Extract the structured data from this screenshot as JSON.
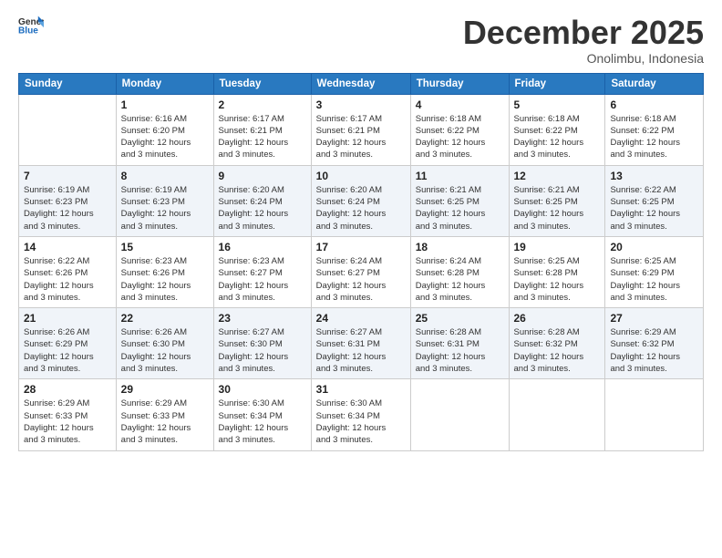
{
  "logo": {
    "general": "General",
    "blue": "Blue"
  },
  "header": {
    "month": "December 2025",
    "location": "Onolimbu, Indonesia"
  },
  "weekdays": [
    "Sunday",
    "Monday",
    "Tuesday",
    "Wednesday",
    "Thursday",
    "Friday",
    "Saturday"
  ],
  "weeks": [
    [
      {
        "day": "",
        "info": ""
      },
      {
        "day": "1",
        "info": "Sunrise: 6:16 AM\nSunset: 6:20 PM\nDaylight: 12 hours\nand 3 minutes."
      },
      {
        "day": "2",
        "info": "Sunrise: 6:17 AM\nSunset: 6:21 PM\nDaylight: 12 hours\nand 3 minutes."
      },
      {
        "day": "3",
        "info": "Sunrise: 6:17 AM\nSunset: 6:21 PM\nDaylight: 12 hours\nand 3 minutes."
      },
      {
        "day": "4",
        "info": "Sunrise: 6:18 AM\nSunset: 6:22 PM\nDaylight: 12 hours\nand 3 minutes."
      },
      {
        "day": "5",
        "info": "Sunrise: 6:18 AM\nSunset: 6:22 PM\nDaylight: 12 hours\nand 3 minutes."
      },
      {
        "day": "6",
        "info": "Sunrise: 6:18 AM\nSunset: 6:22 PM\nDaylight: 12 hours\nand 3 minutes."
      }
    ],
    [
      {
        "day": "7",
        "info": "Sunrise: 6:19 AM\nSunset: 6:23 PM\nDaylight: 12 hours\nand 3 minutes."
      },
      {
        "day": "8",
        "info": "Sunrise: 6:19 AM\nSunset: 6:23 PM\nDaylight: 12 hours\nand 3 minutes."
      },
      {
        "day": "9",
        "info": "Sunrise: 6:20 AM\nSunset: 6:24 PM\nDaylight: 12 hours\nand 3 minutes."
      },
      {
        "day": "10",
        "info": "Sunrise: 6:20 AM\nSunset: 6:24 PM\nDaylight: 12 hours\nand 3 minutes."
      },
      {
        "day": "11",
        "info": "Sunrise: 6:21 AM\nSunset: 6:25 PM\nDaylight: 12 hours\nand 3 minutes."
      },
      {
        "day": "12",
        "info": "Sunrise: 6:21 AM\nSunset: 6:25 PM\nDaylight: 12 hours\nand 3 minutes."
      },
      {
        "day": "13",
        "info": "Sunrise: 6:22 AM\nSunset: 6:25 PM\nDaylight: 12 hours\nand 3 minutes."
      }
    ],
    [
      {
        "day": "14",
        "info": "Sunrise: 6:22 AM\nSunset: 6:26 PM\nDaylight: 12 hours\nand 3 minutes."
      },
      {
        "day": "15",
        "info": "Sunrise: 6:23 AM\nSunset: 6:26 PM\nDaylight: 12 hours\nand 3 minutes."
      },
      {
        "day": "16",
        "info": "Sunrise: 6:23 AM\nSunset: 6:27 PM\nDaylight: 12 hours\nand 3 minutes."
      },
      {
        "day": "17",
        "info": "Sunrise: 6:24 AM\nSunset: 6:27 PM\nDaylight: 12 hours\nand 3 minutes."
      },
      {
        "day": "18",
        "info": "Sunrise: 6:24 AM\nSunset: 6:28 PM\nDaylight: 12 hours\nand 3 minutes."
      },
      {
        "day": "19",
        "info": "Sunrise: 6:25 AM\nSunset: 6:28 PM\nDaylight: 12 hours\nand 3 minutes."
      },
      {
        "day": "20",
        "info": "Sunrise: 6:25 AM\nSunset: 6:29 PM\nDaylight: 12 hours\nand 3 minutes."
      }
    ],
    [
      {
        "day": "21",
        "info": "Sunrise: 6:26 AM\nSunset: 6:29 PM\nDaylight: 12 hours\nand 3 minutes."
      },
      {
        "day": "22",
        "info": "Sunrise: 6:26 AM\nSunset: 6:30 PM\nDaylight: 12 hours\nand 3 minutes."
      },
      {
        "day": "23",
        "info": "Sunrise: 6:27 AM\nSunset: 6:30 PM\nDaylight: 12 hours\nand 3 minutes."
      },
      {
        "day": "24",
        "info": "Sunrise: 6:27 AM\nSunset: 6:31 PM\nDaylight: 12 hours\nand 3 minutes."
      },
      {
        "day": "25",
        "info": "Sunrise: 6:28 AM\nSunset: 6:31 PM\nDaylight: 12 hours\nand 3 minutes."
      },
      {
        "day": "26",
        "info": "Sunrise: 6:28 AM\nSunset: 6:32 PM\nDaylight: 12 hours\nand 3 minutes."
      },
      {
        "day": "27",
        "info": "Sunrise: 6:29 AM\nSunset: 6:32 PM\nDaylight: 12 hours\nand 3 minutes."
      }
    ],
    [
      {
        "day": "28",
        "info": "Sunrise: 6:29 AM\nSunset: 6:33 PM\nDaylight: 12 hours\nand 3 minutes."
      },
      {
        "day": "29",
        "info": "Sunrise: 6:29 AM\nSunset: 6:33 PM\nDaylight: 12 hours\nand 3 minutes."
      },
      {
        "day": "30",
        "info": "Sunrise: 6:30 AM\nSunset: 6:34 PM\nDaylight: 12 hours\nand 3 minutes."
      },
      {
        "day": "31",
        "info": "Sunrise: 6:30 AM\nSunset: 6:34 PM\nDaylight: 12 hours\nand 3 minutes."
      },
      {
        "day": "",
        "info": ""
      },
      {
        "day": "",
        "info": ""
      },
      {
        "day": "",
        "info": ""
      }
    ]
  ]
}
